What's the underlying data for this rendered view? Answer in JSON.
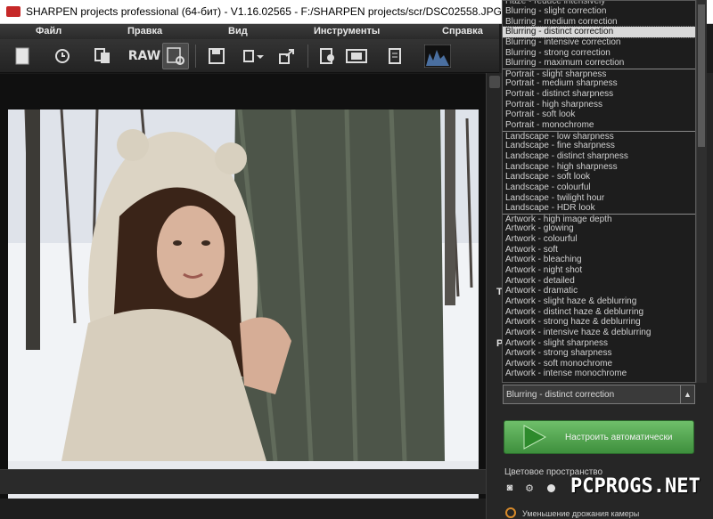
{
  "window": {
    "title": "SHARPEN projects professional (64-бит) - V1.16.02565 - F:/SHARPEN projects/scr/DSC02558.JPG",
    "logo_text": "SHARPEN"
  },
  "menu": {
    "items": [
      "Файл",
      "Правка",
      "Вид",
      "Инструменты",
      "Справка"
    ]
  },
  "toolbar": {
    "raw_label": "RAW",
    "buttons": [
      "new-document",
      "history",
      "copy-compare",
      "raw",
      "settings-grid",
      "save",
      "export-dropdown",
      "share",
      "batch",
      "film",
      "clipboard",
      "histogram"
    ]
  },
  "presets": {
    "partial_top": "Haze - reduce intensively",
    "items": [
      "Blurring - slight correction",
      "Blurring - medium correction",
      "Blurring - distinct correction",
      "Blurring - intensive correction",
      "Blurring - strong correction",
      "Blurring - maximum correction",
      "Portrait - slight sharpness",
      "Portrait - medium sharpness",
      "Portrait - distinct sharpness",
      "Portrait - high sharpness",
      "Portrait - soft look",
      "Portrait - monochrome",
      "Landscape - low sharpness",
      "Landscape - fine sharpness",
      "Landscape - distinct sharpness",
      "Landscape - high sharpness",
      "Landscape - soft look",
      "Landscape - colourful",
      "Landscape - twilight hour",
      "Landscape - HDR look",
      "Artwork - high image depth",
      "Artwork - glowing",
      "Artwork - colourful",
      "Artwork - soft",
      "Artwork - bleaching",
      "Artwork - night shot",
      "Artwork - detailed",
      "Artwork - dramatic",
      "Artwork - slight haze & deblurring",
      "Artwork - distinct haze & deblurring",
      "Artwork - strong haze & deblurring",
      "Artwork - intensive haze & deblurring",
      "Artwork - slight sharpness",
      "Artwork - strong sharpness",
      "Artwork - soft monochrome",
      "Artwork - intense monochrome"
    ],
    "selected": "Blurring - distinct correction"
  },
  "combo": {
    "value": "Blurring - distinct correction",
    "arrow": "▲"
  },
  "side_letters": [
    "T",
    "P"
  ],
  "auto_button": {
    "label": "Настроить автоматически"
  },
  "color_space": {
    "label": "Цветовое пространство"
  },
  "shake": {
    "label": "Уменьшение дрожания камеры"
  },
  "watermark": "PCPROGS.NET"
}
